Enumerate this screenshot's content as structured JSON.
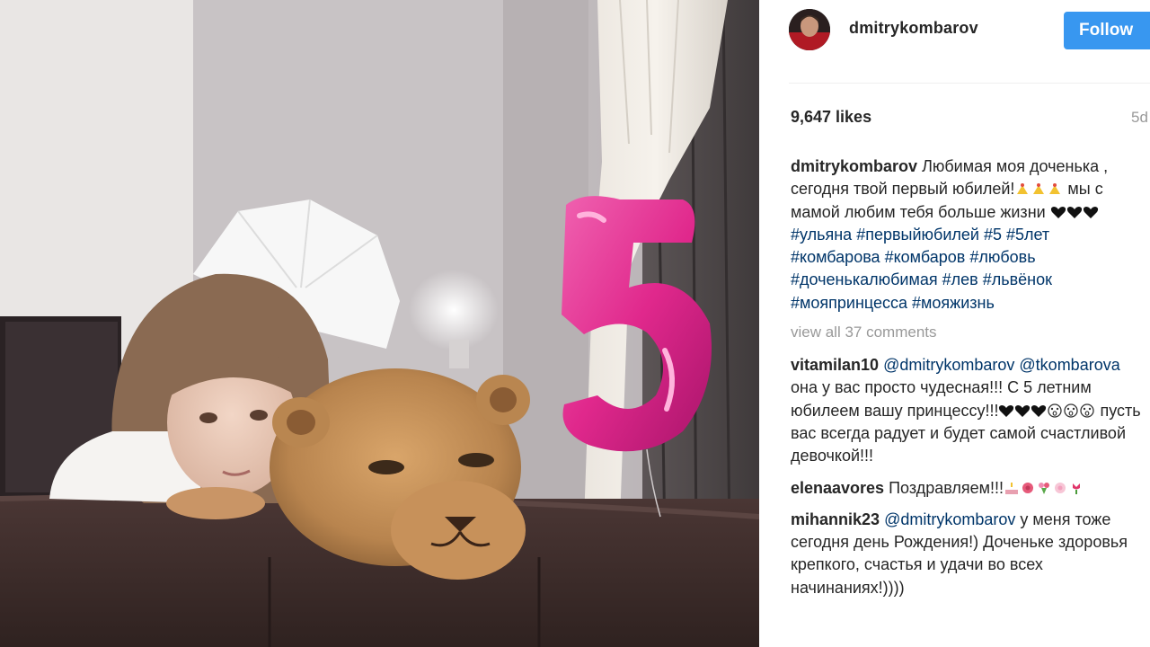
{
  "post": {
    "username": "dmitrykombarov",
    "follow_label": "Follow",
    "likes": "9,647 likes",
    "time_ago": "5d",
    "caption": {
      "user": "dmitrykombarov",
      "text_a": "Любимая моя доченька , сегодня твой первый юбилей!",
      "text_b": " мы с мамой любим тебя больше жизни ",
      "hashtags": "#ульяна #первыйюбилей #5 #5лет #комбарова #комбаров #любовь #доченькалюбимая #лев #львёнок #мояпринцесса #мояжизнь"
    },
    "view_all_comments": "view all 37 comments",
    "comments": [
      {
        "user": "vitamilan10",
        "mention_1": "@dmitrykombarov",
        "mention_2": "@tkombarova",
        "text_a": " она у вас просто чудесная!!! С 5 летним юбилеем вашу принцессу!!!",
        "text_b": " пусть вас всегда радует и будет самой счастливой девочкой!!!"
      },
      {
        "user": "elenaavores",
        "text": "Поздравляем!!!"
      },
      {
        "user": "mihannik23",
        "mention": "@dmitrykombarov",
        "text": " у меня тоже сегодня день Рождения!) Доченьке здоровья крепкого, счастья и удачи во всех начинаниях!))))"
      }
    ]
  },
  "photo": {
    "balloon_text": "5"
  },
  "colors": {
    "follow_bg": "#3897f0",
    "hashtag": "#003569",
    "muted": "#999999",
    "text": "#262626",
    "balloon": "#e0288c"
  },
  "icons": [
    "avatar",
    "fireworks-emoji",
    "black-heart-emoji",
    "shocked-face-emoji",
    "cake-emoji",
    "flower-emoji",
    "bouquet-emoji",
    "tulip-emoji"
  ]
}
